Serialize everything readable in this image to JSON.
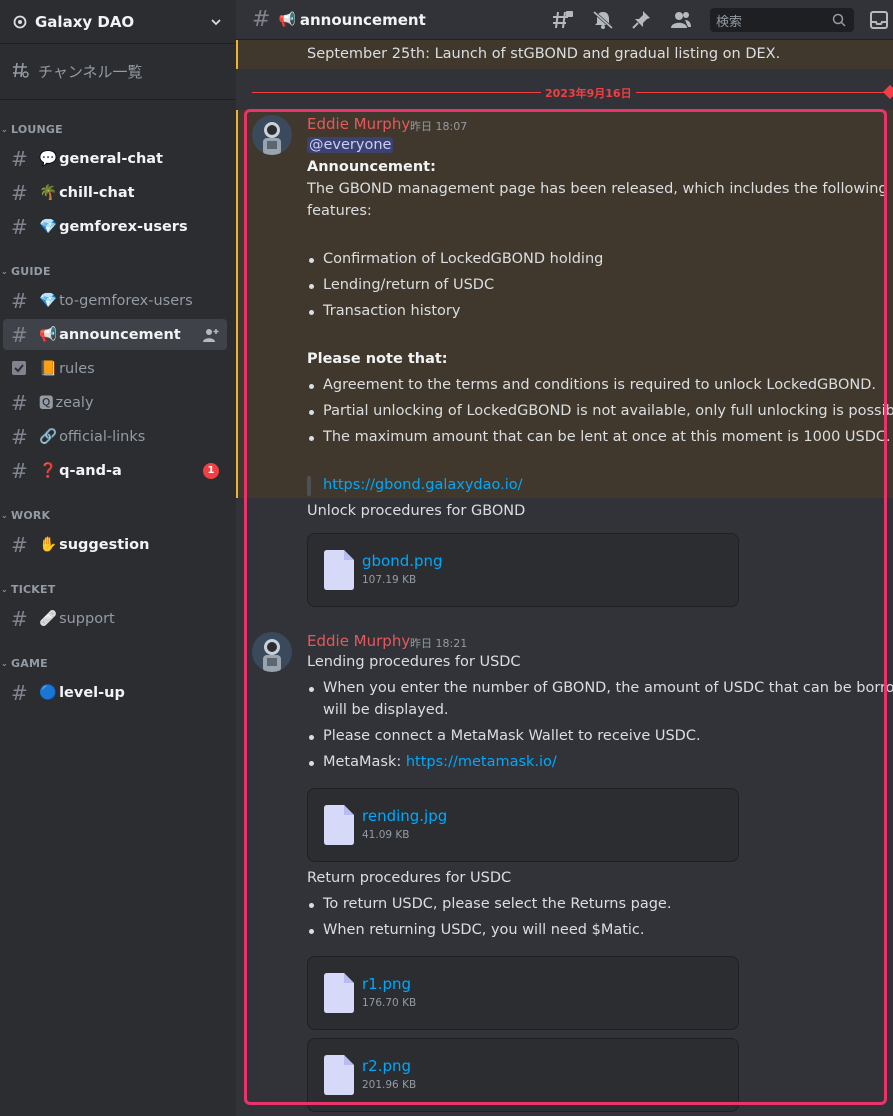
{
  "guild": {
    "name": "Galaxy DAO"
  },
  "sidebar": {
    "browse_label": "チャンネル一覧",
    "categories": [
      {
        "name": "LOUNGE"
      },
      {
        "name": "GUIDE"
      },
      {
        "name": "WORK"
      },
      {
        "name": "TICKET"
      },
      {
        "name": "GAME"
      }
    ],
    "channels": [
      {
        "emoji": "💬",
        "name": "general-chat"
      },
      {
        "emoji": "🌴",
        "name": "chill-chat"
      },
      {
        "emoji": "💎",
        "name": "gemforex-users"
      },
      {
        "emoji": "💎",
        "name": "to-gemforex-users"
      },
      {
        "emoji": "📢",
        "name": "announcement"
      },
      {
        "emoji": "📙",
        "name": "rules"
      },
      {
        "emoji": "🆀",
        "name": "zealy"
      },
      {
        "emoji": "🔗",
        "name": "official-links"
      },
      {
        "emoji": "❓",
        "name": "q-and-a",
        "badge": "1"
      },
      {
        "emoji": "✋",
        "name": "suggestion"
      },
      {
        "emoji": "🩹",
        "name": "support"
      },
      {
        "emoji": "🔵",
        "name": "level-up"
      }
    ]
  },
  "header": {
    "emoji": "📢",
    "channel": "announcement",
    "search_placeholder": "検索"
  },
  "messages": {
    "previous_text": "September 25th: Launch of stGBOND and gradual listing on DEX.",
    "date_divider": "2023年9月16日",
    "first": {
      "author": "Eddie Murphy",
      "timestamp": "昨日 18:07",
      "mention": "@everyone",
      "heading": "Announcement:",
      "intro_1": "The GBOND management page has been released, which includes the following",
      "intro_2": "features:",
      "features": [
        "Confirmation of LockedGBOND holding",
        "Lending/return of USDC",
        "Transaction history"
      ],
      "note_heading": "Please note that:",
      "notes": [
        "Agreement to the terms and conditions is required to unlock LockedGBOND.",
        "Partial unlocking of LockedGBOND is not available, only full unlocking is possible.",
        "The maximum amount that can be lent at once at this moment is 1000 USDC."
      ],
      "link": "https://gbond.galaxydao.io/",
      "unlock_text": "Unlock procedures for GBOND",
      "attachment": {
        "name": "gbond.png",
        "size": "107.19 KB"
      }
    },
    "second": {
      "author": "Eddie Murphy",
      "timestamp": "昨日 18:21",
      "lending_heading": "Lending procedures for USDC",
      "lending_1a": "When you enter the number of GBOND, the amount of USDC that can be borrowed",
      "lending_1b": "will be displayed.",
      "lending_2": "Please connect a MetaMask Wallet to receive USDC.",
      "metamask_label": "MetaMask: ",
      "metamask_link": "https://metamask.io/",
      "attachment_1": {
        "name": "rending.jpg",
        "size": "41.09 KB"
      },
      "return_heading": "Return procedures for USDC",
      "return_1": "To return USDC, please select the Returns page.",
      "return_2": "When returning USDC, you will need $Matic.",
      "attachment_2": {
        "name": "r1.png",
        "size": "176.70 KB"
      },
      "attachment_3": {
        "name": "r2.png",
        "size": "201.96 KB"
      }
    }
  },
  "colors": {
    "mention_red": "#f23f43",
    "author": "#e5595b",
    "link": "#00a8fc",
    "highlight_border": "#f0b232",
    "frame": "#e8336b"
  }
}
